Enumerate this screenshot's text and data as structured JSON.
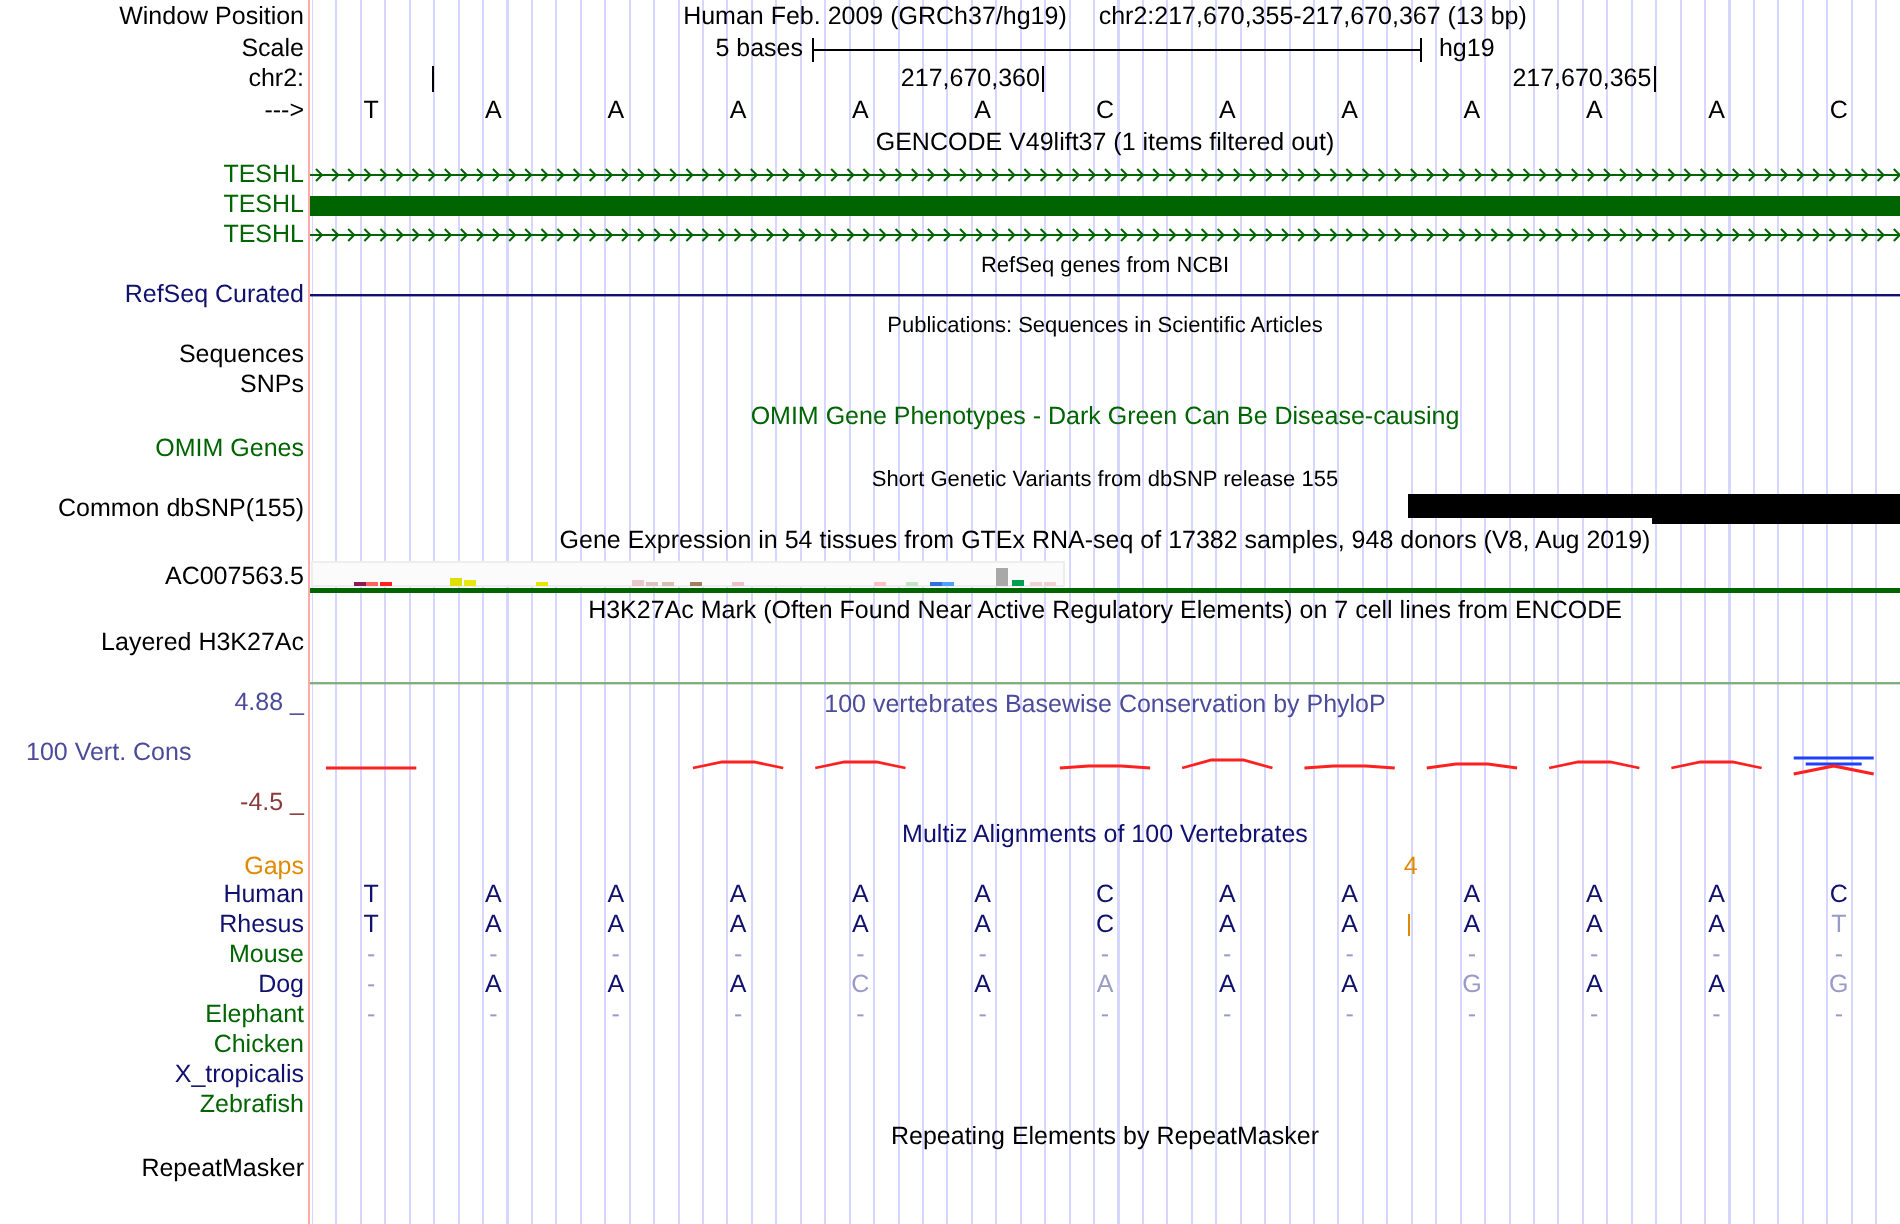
{
  "rows": [
    {
      "kind": "position",
      "label": "Window Position",
      "assembly": "Human Feb. 2009 (GRCh37/hg19)",
      "range": "chr2:217,670,355-217,670,367 (13 bp)"
    },
    {
      "kind": "scale",
      "label": "Scale",
      "left": "5 bases",
      "right": "hg19"
    },
    {
      "kind": "ruler",
      "label": "chr2:",
      "ticks": [
        "217,670,360",
        "217,670,365"
      ]
    },
    {
      "kind": "bases",
      "label": "--->",
      "bases": [
        "T",
        "A",
        "A",
        "A",
        "A",
        "A",
        "C",
        "A",
        "A",
        "A",
        "A",
        "A",
        "C"
      ]
    },
    {
      "kind": "title",
      "text": "GENCODE V49lift37 (1 items filtered out)",
      "color": "#000000",
      "small": false
    },
    {
      "kind": "strand",
      "label": "TESHL",
      "color": "#006400"
    },
    {
      "kind": "block",
      "label": "TESHL",
      "color": "#006400"
    },
    {
      "kind": "strand",
      "label": "TESHL",
      "color": "#006400"
    },
    {
      "kind": "title",
      "text": "RefSeq genes from NCBI",
      "color": "#000000",
      "small": true
    },
    {
      "kind": "line",
      "label": "RefSeq Curated",
      "color": "#10106e"
    },
    {
      "kind": "title",
      "text": "Publications: Sequences in Scientific Articles",
      "color": "#000000",
      "small": true
    },
    {
      "kind": "label",
      "label": "Sequences",
      "color": "#000000"
    },
    {
      "kind": "label",
      "label": "SNPs",
      "color": "#000000"
    },
    {
      "kind": "title",
      "text": "OMIM Gene Phenotypes - Dark Green Can Be Disease-causing",
      "color": "#006400",
      "small": false
    },
    {
      "kind": "label",
      "label": "OMIM Genes",
      "color": "#006400"
    },
    {
      "kind": "title",
      "text": "Short Genetic Variants from dbSNP release 155",
      "color": "#000000",
      "small": true
    },
    {
      "kind": "variants",
      "label": "Common dbSNP(155)",
      "color": "#000000"
    },
    {
      "kind": "title",
      "text": "Gene Expression in 54 tissues from GTEx RNA-seq of 17382 samples, 948 donors (V8, Aug 2019)",
      "color": "#000000",
      "small": false
    },
    {
      "kind": "expression",
      "label": "AC007563.5",
      "color": "#000000"
    },
    {
      "kind": "title",
      "text": "H3K27Ac Mark (Often Found Near Active Regulatory Elements) on 7 cell lines from ENCODE",
      "color": "#000000",
      "small": false
    },
    {
      "kind": "layered",
      "label": "Layered H3K27Ac",
      "color": "#000000"
    },
    {
      "kind": "conservation",
      "max": "4.88 _",
      "label": "100 Vert. Cons",
      "min": "-4.5 _",
      "title": "100 vertebrates Basewise Conservation by PhyloP"
    },
    {
      "kind": "title",
      "text": "Multiz Alignments of 100 Vertebrates",
      "color": "#10106e",
      "small": false
    },
    {
      "kind": "gaps",
      "label": "Gaps",
      "count": "4"
    },
    {
      "kind": "species",
      "label": "Human",
      "color": "#10106e",
      "bases": [
        {
          "b": "T",
          "faded": false
        },
        {
          "b": "A",
          "faded": false
        },
        {
          "b": "A",
          "faded": false
        },
        {
          "b": "A",
          "faded": false
        },
        {
          "b": "A",
          "faded": false
        },
        {
          "b": "A",
          "faded": false
        },
        {
          "b": "C",
          "faded": false
        },
        {
          "b": "A",
          "faded": false
        },
        {
          "b": "A",
          "faded": false
        },
        {
          "b": "A",
          "faded": false
        },
        {
          "b": "A",
          "faded": false
        },
        {
          "b": "A",
          "faded": false
        },
        {
          "b": "C",
          "faded": false
        }
      ]
    },
    {
      "kind": "species",
      "label": "Rhesus",
      "color": "#10106e",
      "bases": [
        {
          "b": "T",
          "faded": false,
          "insert_before": false
        },
        {
          "b": "A",
          "faded": false,
          "insert_before": false
        },
        {
          "b": "A",
          "faded": false,
          "insert_before": false
        },
        {
          "b": "A",
          "faded": false,
          "insert_before": false
        },
        {
          "b": "A",
          "faded": false,
          "insert_before": false
        },
        {
          "b": "A",
          "faded": false,
          "insert_before": false
        },
        {
          "b": "C",
          "faded": false,
          "insert_before": false
        },
        {
          "b": "A",
          "faded": false,
          "insert_before": false
        },
        {
          "b": "A",
          "faded": false,
          "insert_before": false
        },
        {
          "b": "A",
          "faded": false,
          "insert_before": true
        },
        {
          "b": "A",
          "faded": false,
          "insert_before": false
        },
        {
          "b": "A",
          "faded": false,
          "insert_before": false
        },
        {
          "b": "T",
          "faded": true,
          "insert_before": false
        }
      ]
    },
    {
      "kind": "species",
      "label": "Mouse",
      "color": "#006400",
      "bases": [
        {
          "b": "-",
          "faded": true
        },
        {
          "b": "-",
          "faded": true
        },
        {
          "b": "-",
          "faded": true
        },
        {
          "b": "-",
          "faded": true
        },
        {
          "b": "-",
          "faded": true
        },
        {
          "b": "-",
          "faded": true
        },
        {
          "b": "-",
          "faded": true
        },
        {
          "b": "-",
          "faded": true
        },
        {
          "b": "-",
          "faded": true
        },
        {
          "b": "-",
          "faded": true
        },
        {
          "b": "-",
          "faded": true
        },
        {
          "b": "-",
          "faded": true
        },
        {
          "b": "-",
          "faded": true
        }
      ]
    },
    {
      "kind": "species",
      "label": "Dog",
      "color": "#10106e",
      "bases": [
        {
          "b": "-",
          "faded": true
        },
        {
          "b": "A",
          "faded": false
        },
        {
          "b": "A",
          "faded": false
        },
        {
          "b": "A",
          "faded": false
        },
        {
          "b": "C",
          "faded": true
        },
        {
          "b": "A",
          "faded": false
        },
        {
          "b": "A",
          "faded": true
        },
        {
          "b": "A",
          "faded": false
        },
        {
          "b": "A",
          "faded": false
        },
        {
          "b": "G",
          "faded": true
        },
        {
          "b": "A",
          "faded": false
        },
        {
          "b": "A",
          "faded": false
        },
        {
          "b": "G",
          "faded": true
        }
      ]
    },
    {
      "kind": "species",
      "label": "Elephant",
      "color": "#006400",
      "bases": [
        {
          "b": "-",
          "faded": true
        },
        {
          "b": "-",
          "faded": true
        },
        {
          "b": "-",
          "faded": true
        },
        {
          "b": "-",
          "faded": true
        },
        {
          "b": "-",
          "faded": true
        },
        {
          "b": "-",
          "faded": true
        },
        {
          "b": "-",
          "faded": true
        },
        {
          "b": "-",
          "faded": true
        },
        {
          "b": "-",
          "faded": true
        },
        {
          "b": "-",
          "faded": true
        },
        {
          "b": "-",
          "faded": true
        },
        {
          "b": "-",
          "faded": true
        },
        {
          "b": "-",
          "faded": true
        }
      ]
    },
    {
      "kind": "species",
      "label": "Chicken",
      "color": "#006400"
    },
    {
      "kind": "species",
      "label": "X_tropicalis",
      "color": "#10106e"
    },
    {
      "kind": "species",
      "label": "Zebrafish",
      "color": "#006400"
    },
    {
      "kind": "title",
      "text": "Repeating Elements by RepeatMasker",
      "color": "#000000",
      "small": false
    },
    {
      "kind": "label",
      "label": "RepeatMasker",
      "color": "#000000"
    }
  ]
}
